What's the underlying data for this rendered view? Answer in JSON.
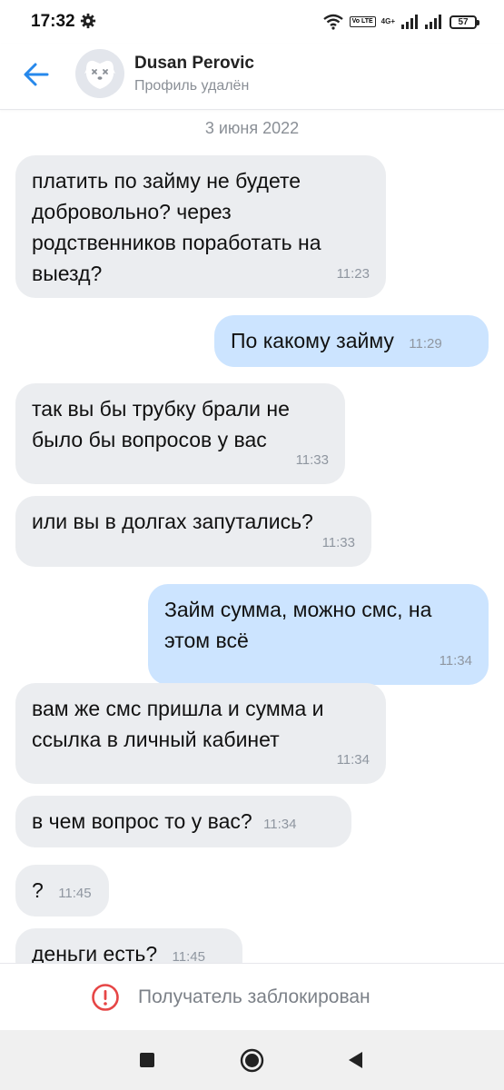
{
  "status_bar": {
    "time": "17:32",
    "network_tag": "4G+",
    "volte_badge": "Vo LTE",
    "battery": "57"
  },
  "header": {
    "contact_name": "Dusan Perovic",
    "contact_status": "Профиль удалён"
  },
  "chat": {
    "date_divider": "3 июня 2022",
    "messages": [
      {
        "direction": "in",
        "text": "платить по займу не будете добровольно? через родственников поработать на выезд?",
        "time": "11:23"
      },
      {
        "direction": "out",
        "text": "По какому займу",
        "time": "11:29"
      },
      {
        "direction": "in",
        "text": "так вы бы трубку брали не было бы вопросов у вас",
        "time": "11:33"
      },
      {
        "direction": "in",
        "text": "или вы в долгах запутались?",
        "time": "11:33"
      },
      {
        "direction": "out",
        "text": "Займ сумма, можно смс, на этом всё",
        "time": "11:34"
      },
      {
        "direction": "in",
        "text": "вам же смс пришла и сумма и ссылка в личный кабинет",
        "time": "11:34"
      },
      {
        "direction": "in",
        "text": "в чем вопрос то у вас?",
        "time": "11:34"
      },
      {
        "direction": "in",
        "text": "?",
        "time": "11:45"
      },
      {
        "direction": "in",
        "text": "деньги есть?",
        "time": "11:45"
      }
    ]
  },
  "blocked_bar": {
    "text": "Получатель заблокирован"
  },
  "colors": {
    "accent": "#2688eb",
    "incoming_bubble": "#ebedf0",
    "outgoing_bubble": "#cce4ff",
    "warning": "#e64646"
  }
}
